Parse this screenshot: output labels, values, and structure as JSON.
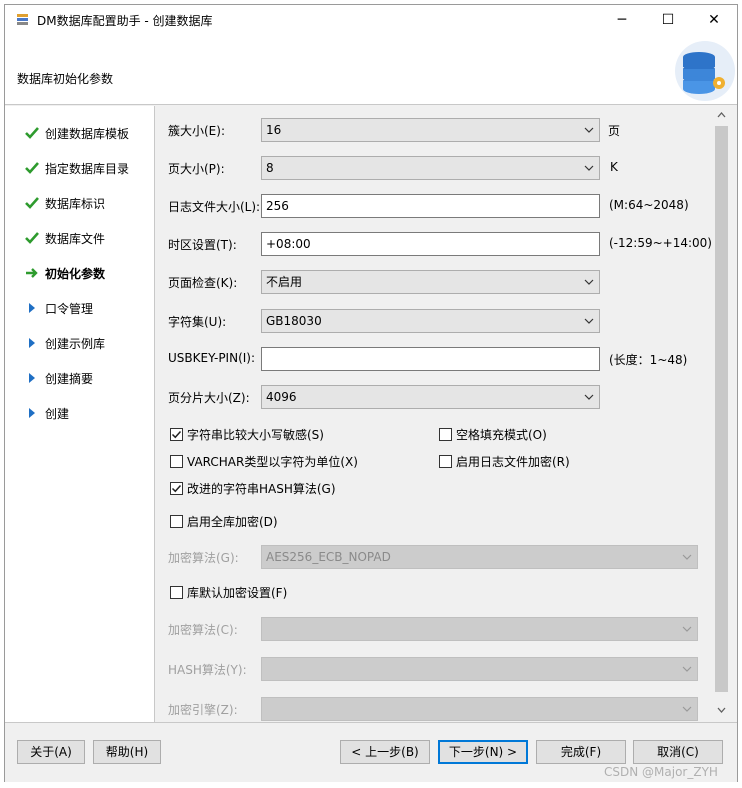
{
  "window": {
    "title": "DM数据库配置助手 - 创建数据库",
    "minimize_glyph": "─",
    "maximize_glyph": "☐",
    "close_glyph": "✕"
  },
  "header": {
    "title": "数据库初始化参数",
    "art_icon": "database-gear-icon"
  },
  "nav": {
    "items": [
      {
        "label": "创建数据库模板",
        "status": "done",
        "icon": "checkmark-icon"
      },
      {
        "label": "指定数据库目录",
        "status": "done",
        "icon": "checkmark-icon"
      },
      {
        "label": "数据库标识",
        "status": "done",
        "icon": "checkmark-icon"
      },
      {
        "label": "数据库文件",
        "status": "done",
        "icon": "checkmark-icon"
      },
      {
        "label": "初始化参数",
        "status": "current",
        "icon": "arrow-right-icon"
      },
      {
        "label": "口令管理",
        "status": "pending",
        "icon": "triangle-right-icon"
      },
      {
        "label": "创建示例库",
        "status": "pending",
        "icon": "triangle-right-icon"
      },
      {
        "label": "创建摘要",
        "status": "pending",
        "icon": "triangle-right-icon"
      },
      {
        "label": "创建",
        "status": "pending",
        "icon": "triangle-right-icon"
      }
    ]
  },
  "form": {
    "extent_size": {
      "label": "簇大小(E):",
      "value": "16",
      "unit": "页"
    },
    "page_size": {
      "label": "页大小(P):",
      "value": "8",
      "unit": "K"
    },
    "log_size": {
      "label": "日志文件大小(L):",
      "value": "256",
      "unit": "(M:64~2048)"
    },
    "time_zone": {
      "label": "时区设置(T):",
      "value": "+08:00",
      "unit": "(-12:59~+14:00)"
    },
    "page_check": {
      "label": "页面检查(K):",
      "value": "不启用"
    },
    "charset": {
      "label": "字符集(U):",
      "value": "GB18030"
    },
    "usbkey_pin": {
      "label": "USBKEY-PIN(I):",
      "value": "",
      "unit": "(长度：1~48)"
    },
    "page_shard_size": {
      "label": "页分片大小(Z):",
      "value": "4096"
    },
    "checkboxes": [
      {
        "label": "字符串比较大小写敏感(S)",
        "checked": true
      },
      {
        "label": "空格填充模式(O)",
        "checked": false
      },
      {
        "label": "VARCHAR类型以字符为单位(X)",
        "checked": false
      },
      {
        "label": "启用日志文件加密(R)",
        "checked": false
      },
      {
        "label": "改进的字符串HASH算法(G)",
        "checked": true
      },
      {
        "label": "启用全库加密(D)",
        "checked": false
      }
    ],
    "encrypt_algo": {
      "label": "加密算法(G):",
      "value": "AES256_ECB_NOPAD"
    },
    "default_encrypt": {
      "label": "库默认加密设置(F)",
      "checked": false
    },
    "encrypt_algo2": {
      "label": "加密算法(C):",
      "value": ""
    },
    "hash_algo": {
      "label": "HASH算法(Y):",
      "value": ""
    },
    "encrypt_engine": {
      "label": "加密引擎(Z):",
      "value": ""
    }
  },
  "buttons": {
    "about": "关于(A)",
    "help": "帮助(H)",
    "prev": "< 上一步(B)",
    "next": "下一步(N) >",
    "finish": "完成(F)",
    "cancel": "取消(C)"
  },
  "watermark": "CSDN @Major_ZYH",
  "colors": {
    "check_green": "#2e9b2e",
    "arrow_blue": "#1f6fc4",
    "default_button_border": "#0078d7"
  }
}
